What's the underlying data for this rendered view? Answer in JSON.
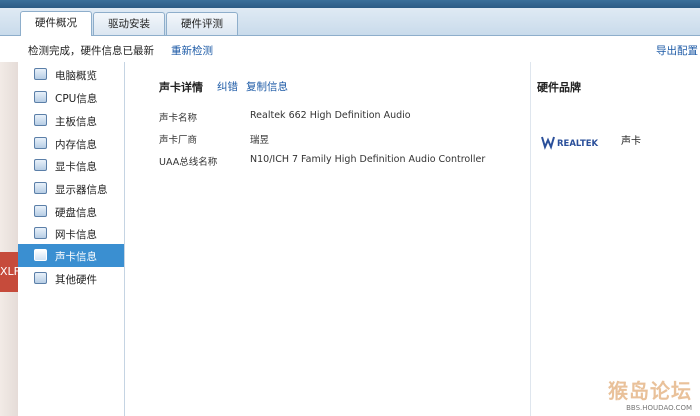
{
  "tabs": [
    {
      "label": "硬件概况",
      "active": true
    },
    {
      "label": "驱动安装",
      "active": false
    },
    {
      "label": "硬件评测",
      "active": false
    }
  ],
  "toolbar": {
    "status": "检测完成，硬件信息已最新",
    "recheck": "重新检测",
    "export": "导出配置"
  },
  "sidebar": {
    "items": [
      {
        "label": "电脑概览",
        "icon": "overview-icon"
      },
      {
        "label": "CPU信息",
        "icon": "cpu-icon"
      },
      {
        "label": "主板信息",
        "icon": "motherboard-icon"
      },
      {
        "label": "内存信息",
        "icon": "memory-icon"
      },
      {
        "label": "显卡信息",
        "icon": "graphics-card-icon"
      },
      {
        "label": "显示器信息",
        "icon": "monitor-icon"
      },
      {
        "label": "硬盘信息",
        "icon": "hard-disk-icon"
      },
      {
        "label": "网卡信息",
        "icon": "network-card-icon"
      },
      {
        "label": "声卡信息",
        "icon": "sound-card-icon",
        "active": true
      },
      {
        "label": "其他硬件",
        "icon": "other-hardware-icon"
      }
    ]
  },
  "detail": {
    "title": "声卡详情",
    "fix": "纠错",
    "copy": "复制信息",
    "rows": [
      {
        "label": "声卡名称",
        "value": "Realtek 662 High Definition Audio"
      },
      {
        "label": "声卡厂商",
        "value": "瑞昱"
      },
      {
        "label": "UAA总线名称",
        "value": "N10/ICH 7 Family High Definition Audio Controller"
      }
    ]
  },
  "brand": {
    "title": "硬件品牌",
    "logo_text": "REALTEK",
    "item": "声卡"
  },
  "watermark": {
    "main": "猴岛论坛",
    "sub": "BBS.HOUDAO.COM"
  },
  "left_badge": "XLF",
  "colors": {
    "accent": "#3a8fd1",
    "link": "#1c5aa6"
  }
}
